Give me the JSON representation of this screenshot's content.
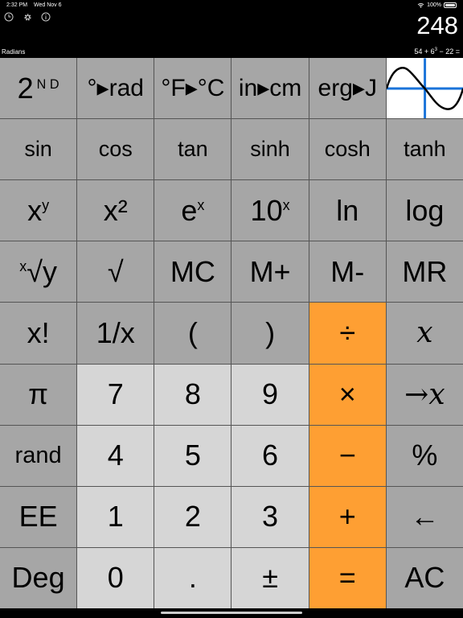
{
  "status": {
    "time": "2:32 PM",
    "date": "Wed Nov 6",
    "battery": "100%"
  },
  "display": {
    "value": "248",
    "mode": "Radians",
    "expression_base": "54 + 6",
    "expression_exp": "3",
    "expression_tail": " − 22 ="
  },
  "keys": {
    "second": {
      "main": "2",
      "sup": "N D"
    },
    "deg_rad": "°▸rad",
    "f_c": "°F▸°C",
    "in_cm": "in▸cm",
    "erg_j": "erg▸J",
    "sin": "sin",
    "cos": "cos",
    "tan": "tan",
    "sinh": "sinh",
    "cosh": "cosh",
    "tanh": "tanh",
    "xy": {
      "main": "x",
      "sup": "y"
    },
    "x2": "x²",
    "ex": {
      "main": "e",
      "sup": "x"
    },
    "tenx": {
      "main": "10",
      "sup": "x"
    },
    "ln": "ln",
    "log": "log",
    "xrooty": {
      "sup": "x",
      "main": "√y"
    },
    "sqrt": "√",
    "mc": "MC",
    "mplus": "M+",
    "mminus": "M-",
    "mr": "MR",
    "fact": "x!",
    "recip": "1/x",
    "lparen": "(",
    "rparen": ")",
    "divide": "÷",
    "var_x": "x",
    "pi": "π",
    "seven": "7",
    "eight": "8",
    "nine": "9",
    "multiply": "×",
    "store_x": "→x",
    "rand": "rand",
    "four": "4",
    "five": "5",
    "six": "6",
    "minus": "−",
    "percent": "%",
    "ee": "EE",
    "one": "1",
    "two": "2",
    "three": "3",
    "plus": "+",
    "backspace": "←",
    "deg": "Deg",
    "zero": "0",
    "dot": ".",
    "plusminus": "±",
    "equals": "=",
    "ac": "AC"
  },
  "colors": {
    "dark_key": "#a6a6a6",
    "light_key": "#d6d6d6",
    "orange_key": "#fe9f33",
    "graph_line": "#1a73d9"
  }
}
